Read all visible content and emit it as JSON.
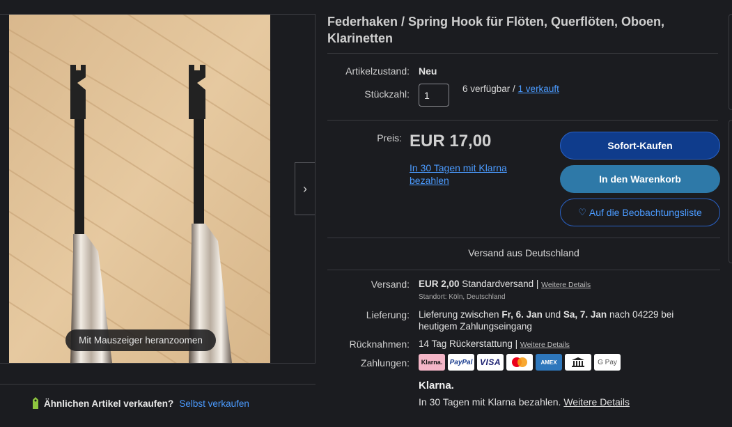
{
  "gallery": {
    "zoom_hint": "Mit Mauszeiger heranzoomen",
    "next_icon": "chevron-right-icon",
    "next_glyph": "›"
  },
  "sell_similar": {
    "question": "Ähnlichen Artikel verkaufen?",
    "link": "Selbst verkaufen",
    "icon": "tag-icon"
  },
  "item": {
    "title": "Federhaken / Spring Hook für Flöten, Querflöten, Oboen, Klarinetten",
    "condition_label": "Artikelzustand:",
    "condition_value": "Neu",
    "quantity_label": "Stückzahl:",
    "quantity_value": "1",
    "available_text": "6 verfügbar / ",
    "sold_link": "1 verkauft"
  },
  "pricing": {
    "price_label": "Preis:",
    "price": "EUR 17,00",
    "klarna_offer": "In 30 Tagen mit Klarna bezahlen"
  },
  "actions": {
    "buy_now": "Sofort-Kaufen",
    "add_to_cart": "In den Warenkorb",
    "watch_icon": "heart-icon",
    "watch_glyph": "♡",
    "watch": "Auf die Beobachtungsliste"
  },
  "shipping": {
    "ships_from": "Versand aus Deutschland",
    "shipping_label": "Versand:",
    "shipping_cost": "EUR 2,00",
    "shipping_type": "Standardversand |",
    "shipping_details": "Weitere Details",
    "location": "Standort: Köln, Deutschland",
    "delivery_label": "Lieferung:",
    "delivery_prefix": "Lieferung zwischen ",
    "delivery_from": "Fr, 6. Jan",
    "delivery_and": " und ",
    "delivery_to": "Sa, 7. Jan",
    "delivery_suffix": " nach 04229 bei heutigem Zahlungseingang",
    "returns_label": "Rücknahmen:",
    "returns_value": "14 Tag Rückerstattung |",
    "returns_details": "Weitere Details",
    "payments_label": "Zahlungen:"
  },
  "payments": [
    {
      "name": "klarna",
      "label": "Klarna."
    },
    {
      "name": "paypal",
      "label": "PayPal"
    },
    {
      "name": "visa",
      "label": "VISA"
    },
    {
      "name": "mastercard",
      "label": ""
    },
    {
      "name": "amex",
      "label": "AMEX"
    },
    {
      "name": "bank",
      "label": ""
    },
    {
      "name": "googlepay",
      "label": "G Pay"
    }
  ],
  "klarna": {
    "logo": "Klarna.",
    "note": "In 30 Tagen mit Klarna bezahlen.",
    "details": "Weitere Details"
  },
  "colors": {
    "background": "#1b1c20",
    "link": "#4b9bff",
    "buy_button": "#0f3c8c",
    "cart_button": "#2e79a8"
  }
}
